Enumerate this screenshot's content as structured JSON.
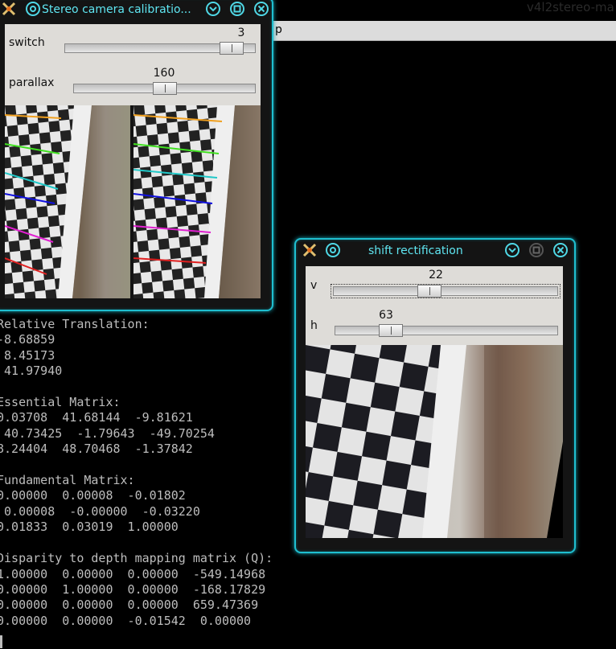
{
  "background": {
    "window_title": "v4l2stereo-ma",
    "bar_text": "p",
    "terminal_lines": [
      "Relative Translation:",
      "-8.68859",
      " 8.45173",
      " 41.97940",
      "",
      "Essential Matrix:",
      "0.03708  41.68144  -9.81621",
      " 40.73425  -1.79643  -49.70254",
      "8.24404  48.70468  -1.37842",
      "",
      "Fundamental Matrix:",
      "0.00000  0.00008  -0.01802",
      " 0.00008  -0.00000  -0.03220",
      "0.01833  0.03019  1.00000",
      "",
      "Disparity to depth mapping matrix (Q):",
      "1.00000  0.00000  0.00000  -549.14968",
      "0.00000  1.00000  0.00000  -168.17829",
      "0.00000  0.00000  0.00000  659.47369",
      "0.00000  0.00000  -0.01542  0.00000"
    ]
  },
  "calib_window": {
    "title": "Stereo camera calibratio...",
    "sliders": [
      {
        "label": "switch",
        "value": "3",
        "fraction": 0.93
      },
      {
        "label": "parallax",
        "value": "160",
        "fraction": 0.5
      }
    ]
  },
  "shift_window": {
    "title": "shift rectification",
    "sliders": [
      {
        "label": "v",
        "value": "22",
        "fraction": 0.42
      },
      {
        "label": "h",
        "value": "63",
        "fraction": 0.22
      }
    ]
  },
  "colors": {
    "accent": "#1fbfd0",
    "chessboard_lines": [
      "#f0a020",
      "#40e020",
      "#20c8c8",
      "#1010e0",
      "#e020d0",
      "#e02020"
    ]
  }
}
